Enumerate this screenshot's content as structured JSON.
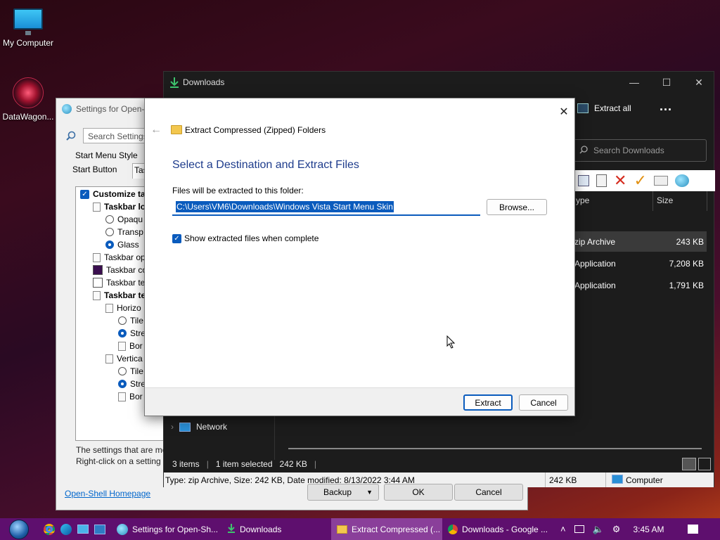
{
  "desktop": {
    "icons": [
      {
        "label": "My Computer",
        "icon": "monitor-icon"
      },
      {
        "label": "DataWagon...",
        "icon": "datawagon-icon"
      }
    ]
  },
  "settings": {
    "title": "Settings for Open-",
    "search_placeholder": "Search Settings",
    "tabs": [
      "Start Menu Style",
      "Start Button",
      "Task"
    ],
    "tree": [
      {
        "label": "Customize ta",
        "type": "checkbox",
        "bold": true,
        "level": 0
      },
      {
        "label": "Taskbar lo",
        "type": "page",
        "bold": true,
        "level": 1
      },
      {
        "label": "Opaqu",
        "type": "radio",
        "on": false,
        "level": 2
      },
      {
        "label": "Transp",
        "type": "radio",
        "on": false,
        "level": 2
      },
      {
        "label": "Glass",
        "type": "radio",
        "on": true,
        "level": 2
      },
      {
        "label": "Taskbar op",
        "type": "page",
        "level": 1
      },
      {
        "label": "Taskbar co",
        "type": "color",
        "color": "#3a0e4f",
        "level": 1
      },
      {
        "label": "Taskbar te",
        "type": "color",
        "color": "#ffffff",
        "level": 1
      },
      {
        "label": "Taskbar te",
        "type": "page",
        "bold": true,
        "level": 1
      },
      {
        "label": "Horizo",
        "type": "page",
        "level": 2
      },
      {
        "label": "Tile",
        "type": "radio",
        "on": false,
        "level": 3
      },
      {
        "label": "Stre",
        "type": "radio",
        "on": true,
        "level": 3
      },
      {
        "label": "Bor",
        "type": "page",
        "level": 3
      },
      {
        "label": "Vertica",
        "type": "page",
        "level": 2
      },
      {
        "label": "Tile",
        "type": "radio",
        "on": false,
        "level": 3
      },
      {
        "label": "Stre",
        "type": "radio",
        "on": true,
        "level": 3
      },
      {
        "label": "Bor",
        "type": "page",
        "level": 3
      }
    ],
    "hint_line1": "The settings that are mo",
    "hint_line2": "Right-click on a setting",
    "homepage_link": "Open-Shell Homepage",
    "backup_label": "Backup",
    "ok_label": "OK",
    "cancel_label": "Cancel"
  },
  "explorer": {
    "title": "Downloads",
    "extract_all": "Extract all",
    "more": "...",
    "search_placeholder": "Search Downloads",
    "columns": {
      "type": "ype",
      "size": "Size"
    },
    "rows": [
      {
        "type": "zip Archive",
        "size": "243 KB",
        "selected": true
      },
      {
        "type": "Application",
        "size": "7,208 KB",
        "selected": false
      },
      {
        "type": "Application",
        "size": "1,791 KB",
        "selected": false
      }
    ],
    "nav_network": "Network",
    "status_items": "3 items",
    "status_selected": "1 item selected",
    "status_size": "242 KB",
    "info_text": "Type: zip Archive, Size: 242 KB, Date modified: 8/13/2022 3:44 AM",
    "info_size": "242 KB",
    "info_location": "Computer"
  },
  "dialog": {
    "breadcrumb": "Extract Compressed (Zipped) Folders",
    "heading": "Select a Destination and Extract Files",
    "folder_label": "Files will be extracted to this folder:",
    "path_value": "C:\\Users\\VM6\\Downloads\\Windows Vista Start Menu Skin",
    "browse_label": "Browse...",
    "show_files_label": "Show extracted files when complete",
    "extract_label": "Extract",
    "cancel_label": "Cancel",
    "accent": "#0a5bbd"
  },
  "taskbar": {
    "color": "#5e0f6e",
    "buttons": [
      {
        "label": "Settings for Open-Sh...",
        "icon": "open-shell-icon",
        "active": false
      },
      {
        "label": "Downloads",
        "icon": "download-folder-icon",
        "active": false
      },
      {
        "label": "Extract Compressed (...",
        "icon": "folder-icon",
        "active": true
      },
      {
        "label": "Downloads - Google ...",
        "icon": "chrome-icon",
        "active": false
      }
    ],
    "clock": "3:45 AM"
  }
}
